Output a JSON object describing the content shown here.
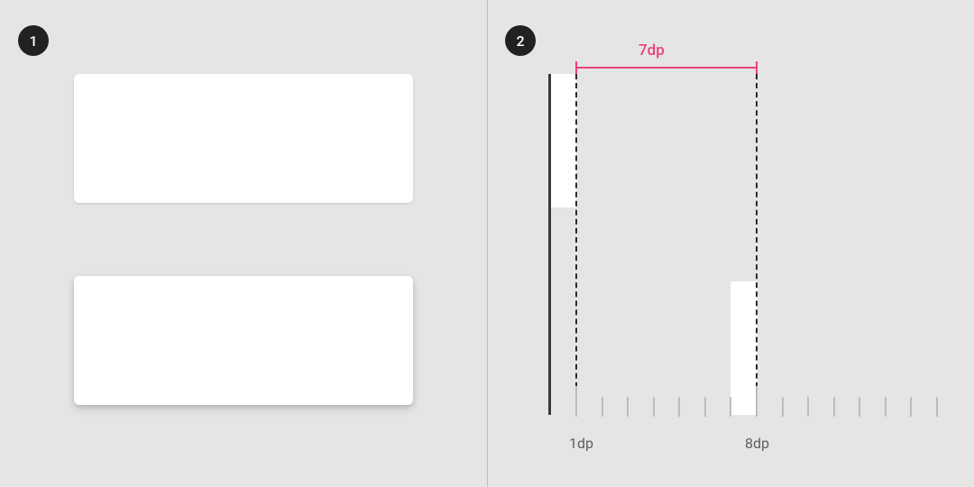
{
  "badges": {
    "left": "1",
    "right": "2"
  },
  "measurement": {
    "label": "7dp"
  },
  "axis": {
    "start_label": "1dp",
    "mid_label": "8dp"
  },
  "chart_data": {
    "type": "bar",
    "title": "",
    "xlabel": "dp",
    "ylabel": "",
    "x_range": [
      0,
      16
    ],
    "ticks": [
      1,
      2,
      3,
      4,
      5,
      6,
      7,
      8,
      9,
      10,
      11,
      12,
      13,
      14,
      15
    ],
    "dashed_guides_at": [
      1,
      8
    ],
    "measured_span": {
      "from": 1,
      "to": 8,
      "value": "7dp",
      "color": "#ec407a"
    },
    "white_regions": [
      {
        "x": 0,
        "width_dp": 1,
        "note": "tall strip against baseline"
      },
      {
        "x": 7,
        "width_dp": 1,
        "note": "short strip at 8dp guide"
      }
    ]
  }
}
